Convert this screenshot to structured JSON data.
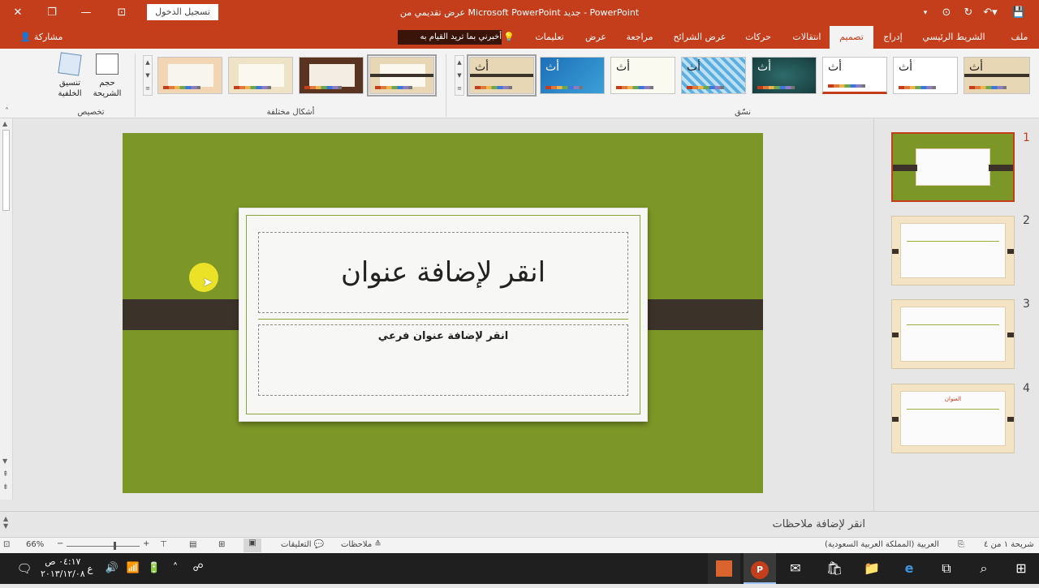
{
  "titlebar": {
    "title": "عرض تقديمي من Microsoft PowerPoint جديد  -  PowerPoint",
    "signin": "تسجيل الدخول"
  },
  "tabs": [
    {
      "label": "ملف"
    },
    {
      "label": "الشريط الرئيسي"
    },
    {
      "label": "إدراج"
    },
    {
      "label": "تصميم"
    },
    {
      "label": "انتقالات"
    },
    {
      "label": "حركات"
    },
    {
      "label": "عرض الشرائح"
    },
    {
      "label": "مراجعة"
    },
    {
      "label": "عرض"
    },
    {
      "label": "تعليمات"
    }
  ],
  "tellme": "أخبرني بما تريد القيام به",
  "share": "مشاركة",
  "ribbon": {
    "customize": {
      "slide_size": "حجم الشريحة",
      "format_bg": "تنسيق الخلفية",
      "label": "تخصيص"
    },
    "variants_label": "أشكال مختلفة",
    "themes_label": "نسّق",
    "theme_glyph": "أث"
  },
  "slide": {
    "title": "انقر لإضافة عنوان",
    "subtitle": "انقر لإضافة عنوان فرعي"
  },
  "panel": {
    "numbers": [
      "1",
      "2",
      "3",
      "4"
    ],
    "thumb4_title": "العنوان"
  },
  "notes": "انقر لإضافة ملاحظات",
  "status": {
    "slide_counter": "شريحة ١ من ٤",
    "language": "العربية (المملكة العربية السعودية)",
    "notes_btn": "ملاحظات",
    "comments_btn": "التعليقات",
    "zoom": "66%"
  },
  "taskbar": {
    "time": "٠٤:١٧ ص",
    "date": "٢٠١٣/١٢/٠٨",
    "lang": "ع"
  },
  "colors": {
    "accent": "#c43e1c",
    "slide_bg": "#7c9627",
    "band": "#3b3229"
  }
}
